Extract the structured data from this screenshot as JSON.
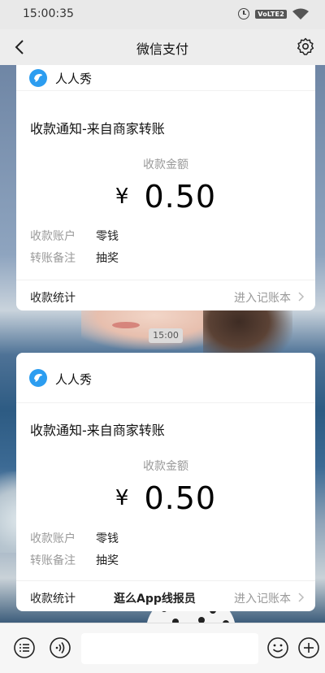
{
  "status_bar": {
    "time": "15:00:35",
    "network_badge": "VoLTE2",
    "icons": [
      "alarm-icon",
      "volte-icon",
      "wifi-icon"
    ]
  },
  "nav": {
    "title": "微信支付",
    "back_icon": "chevron-left-icon",
    "settings_icon": "gear-icon"
  },
  "messages": [
    {
      "app_name": "人人秀",
      "amount_label": "收款金额",
      "currency": "¥",
      "amount": "0.50",
      "details": [
        {
          "key": "收款账户",
          "value": "零钱"
        },
        {
          "key": "转账备注",
          "value": "抽奖"
        }
      ],
      "footer_left": "收款统计",
      "footer_right": "进入记账本"
    },
    {
      "app_name": "人人秀",
      "title": "收款通知-来自商家转账",
      "amount_label": "收款金额",
      "currency": "¥",
      "amount": "0.50",
      "details": [
        {
          "key": "收款账户",
          "value": "零钱"
        },
        {
          "key": "转账备注",
          "value": "抽奖"
        }
      ],
      "footer_left": "收款统计",
      "footer_right": "进入记账本"
    }
  ],
  "first_card_title": "收款通知-来自商家转账",
  "chat_time": "15:00",
  "watermark": "逛么App线报员",
  "bottom_bar": {
    "icons": [
      "menu-list-icon",
      "voice-icon",
      "emoji-icon",
      "plus-icon"
    ]
  },
  "colors": {
    "accent_blue": "#2c9df0",
    "card_bg": "#ffffff",
    "secondary_text": "#999999"
  }
}
